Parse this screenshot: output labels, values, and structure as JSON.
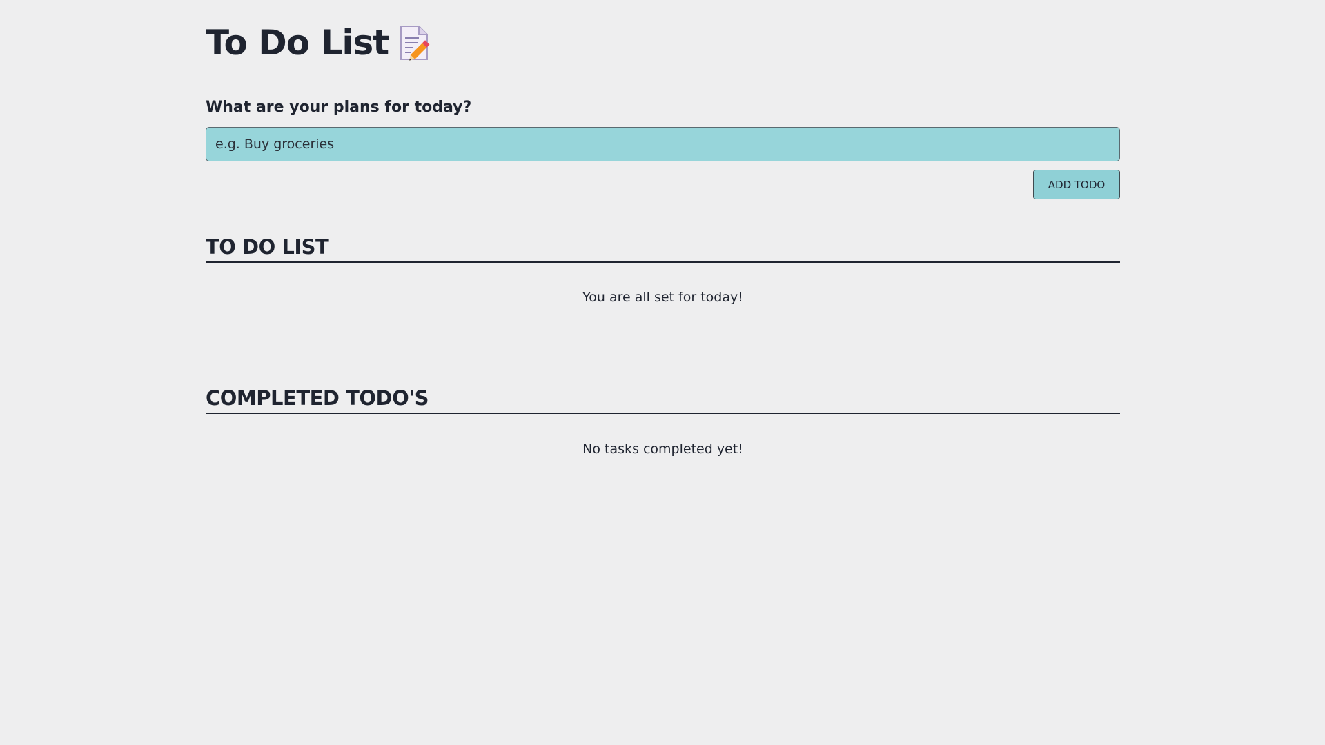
{
  "header": {
    "title": "To Do List",
    "icon": "memo-icon"
  },
  "form": {
    "prompt": "What are your plans for today?",
    "input_placeholder": "e.g. Buy groceries",
    "input_value": "",
    "add_button_label": "ADD TODO"
  },
  "todo_section": {
    "heading": "TO DO LIST",
    "items": [],
    "empty_message": "You are all set for today!"
  },
  "completed_section": {
    "heading": "COMPLETED TODO'S",
    "items": [],
    "empty_message": "No tasks completed yet!"
  },
  "colors": {
    "background": "#eeeeef",
    "accent": "#97d5da",
    "text": "#1f2430"
  }
}
